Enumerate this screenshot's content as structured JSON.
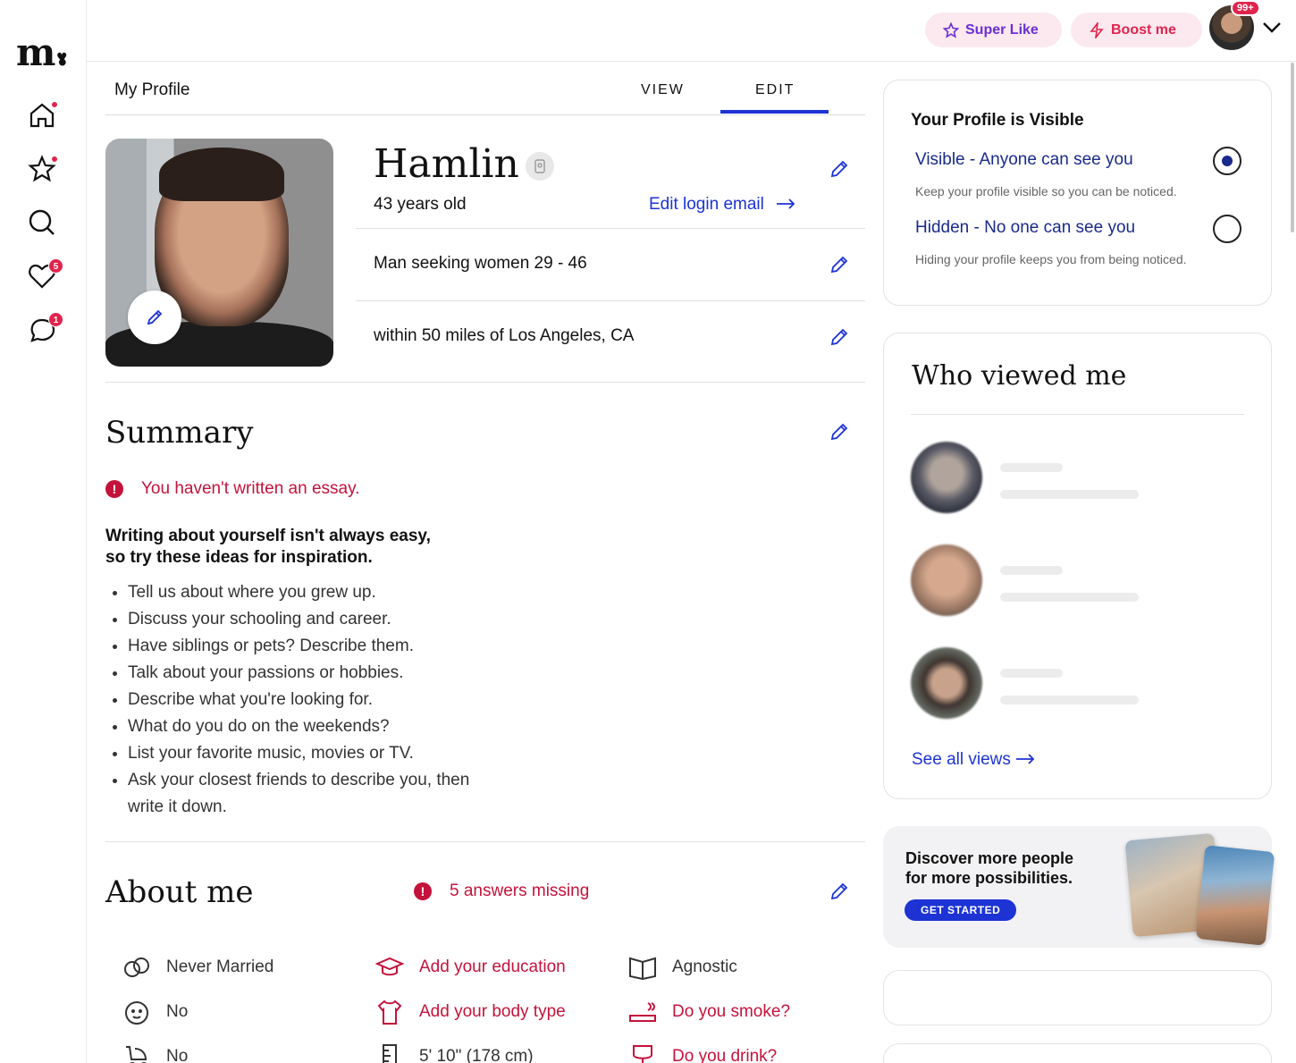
{
  "brand": {
    "logo": "m."
  },
  "topbar": {
    "super_like": "Super Like",
    "boost_me": "Boost me",
    "notifications_badge": "99+"
  },
  "leftnav": {
    "likes_badge": "5",
    "messages_badge": "1"
  },
  "profile_header": {
    "title": "My Profile",
    "tabs": [
      {
        "label": "VIEW",
        "active": false
      },
      {
        "label": "EDIT",
        "active": true
      }
    ]
  },
  "profile": {
    "name": "Hamlin",
    "age": "43 years old",
    "edit_login_email": "Edit login email",
    "seeking": "Man seeking women 29 - 46",
    "location": "within 50 miles of Los Angeles, CA"
  },
  "summary": {
    "title": "Summary",
    "warning": "You haven't written an essay.",
    "ideas_heading_line1": "Writing about yourself isn't always easy,",
    "ideas_heading_line2": "so try these ideas for inspiration.",
    "ideas": [
      "Tell us about where you grew up.",
      "Discuss your schooling and career.",
      "Have siblings or pets? Describe them.",
      "Talk about your passions or hobbies.",
      "Describe what you're looking for.",
      "What do you do on the weekends?",
      "List your favorite music, movies or TV.",
      "Ask your closest friends to describe you, then write it down."
    ]
  },
  "about": {
    "title": "About me",
    "missing": "5 answers missing",
    "items": [
      {
        "label": "Never Married",
        "icon": "rings-icon",
        "missing": false
      },
      {
        "label": "Add your education",
        "icon": "graduation-cap-icon",
        "missing": true
      },
      {
        "label": "Agnostic",
        "icon": "book-icon",
        "missing": false
      },
      {
        "label": "No",
        "icon": "baby-face-icon",
        "missing": false
      },
      {
        "label": "Add your body type",
        "icon": "shirt-icon",
        "missing": true
      },
      {
        "label": "Do you smoke?",
        "icon": "cigarette-icon",
        "missing": true
      },
      {
        "label": "No",
        "icon": "stroller-icon",
        "missing": false
      },
      {
        "label": "5' 10\" (178 cm)",
        "icon": "ruler-icon",
        "missing": false
      },
      {
        "label": "Do you drink?",
        "icon": "glass-icon",
        "missing": true
      }
    ]
  },
  "visibility": {
    "title": "Your Profile is Visible",
    "visible_label": "Visible - Anyone can see you",
    "visible_sub": "Keep your profile visible so you can be noticed.",
    "hidden_label": "Hidden - No one can see you",
    "hidden_sub": "Hiding your profile keeps you from being noticed.",
    "selected": "visible"
  },
  "views": {
    "title": "Who viewed me",
    "see_all": "See all views"
  },
  "promo": {
    "text_line1": "Discover more people",
    "text_line2": "for more possibilities.",
    "cta": "GET STARTED"
  },
  "colors": {
    "accent_blue": "#1d33d4",
    "alert_red": "#c4133b",
    "brand_pink": "#e0244e",
    "super_like_purple": "#6b2fd6"
  }
}
